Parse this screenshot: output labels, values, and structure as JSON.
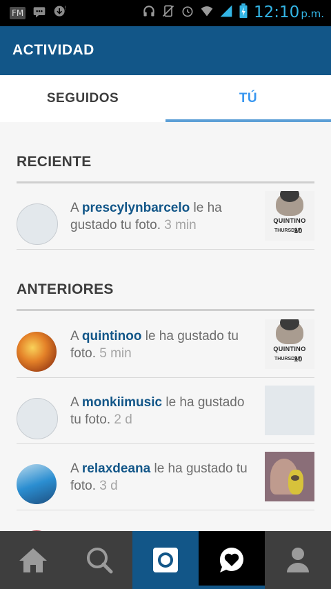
{
  "status_bar": {
    "fm_label": "FM",
    "time": "12:10",
    "ampm": "p.m.",
    "icons": [
      "message-icon",
      "download-icon",
      "headphones-icon",
      "silent-icon",
      "alarm-icon",
      "wifi-icon",
      "signal-icon",
      "battery-icon"
    ]
  },
  "header": {
    "title": "ACTIVIDAD"
  },
  "tabs": [
    {
      "label": "SEGUIDOS",
      "active": false
    },
    {
      "label": "TÚ",
      "active": true
    }
  ],
  "sections": {
    "recent": {
      "title": "RECIENTE",
      "items": [
        {
          "prefix": "A ",
          "username": "prescylynbarcelo",
          "text": " le ha gustado tu foto. ",
          "time": "3 min"
        }
      ]
    },
    "earlier": {
      "title": "ANTERIORES",
      "items": [
        {
          "prefix": "A ",
          "username": "quintinoo",
          "text": " le ha gustado tu foto. ",
          "time": "5 min"
        },
        {
          "prefix": "A ",
          "username": "monkiimusic",
          "text": " le ha gustado tu foto. ",
          "time": "2 d"
        },
        {
          "prefix": "A ",
          "username": "relaxdeana",
          "text": " le ha gustado tu foto. ",
          "time": "3 d"
        }
      ]
    }
  },
  "poster": {
    "title": "QUINTINO",
    "sub": "THURSDAY",
    "day": "10"
  },
  "bottom_nav": [
    {
      "name": "home",
      "icon": "home-icon"
    },
    {
      "name": "search",
      "icon": "search-icon"
    },
    {
      "name": "camera",
      "icon": "camera-icon"
    },
    {
      "name": "activity",
      "icon": "activity-heart-icon",
      "active": true
    },
    {
      "name": "profile",
      "icon": "profile-icon"
    }
  ],
  "colors": {
    "brand": "#125688",
    "tab_active": "#3897f0",
    "status_time": "#33b5e5"
  }
}
